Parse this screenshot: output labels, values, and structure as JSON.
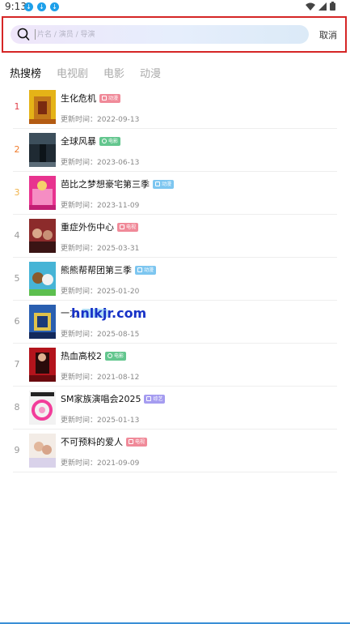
{
  "status_bar": {
    "time": "9:13",
    "download_icons": [
      "download-icon",
      "download-icon",
      "download-icon"
    ]
  },
  "search": {
    "placeholder": "片名 / 演员 / 导演",
    "cancel_label": "取消"
  },
  "tabs": [
    {
      "label": "热搜榜",
      "active": true
    },
    {
      "label": "电视剧",
      "active": false
    },
    {
      "label": "电影",
      "active": false
    },
    {
      "label": "动漫",
      "active": false
    }
  ],
  "update_prefix": "更新时间：",
  "items": [
    {
      "rank": "1",
      "title": "生化危机",
      "badge": "动漫",
      "update": "2022-09-13",
      "rank_color": "#e0404a",
      "badge_color": "#f08a99"
    },
    {
      "rank": "2",
      "title": "全球风暴",
      "badge": "电影",
      "update": "2023-06-13",
      "rank_color": "#f07a2a",
      "badge_color": "#63c68e"
    },
    {
      "rank": "3",
      "title": "芭比之梦想豪宅第三季",
      "badge": "动漫",
      "update": "2023-11-09",
      "rank_color": "#f0b34a",
      "badge_color": "#7dc6f0"
    },
    {
      "rank": "4",
      "title": "重症外伤中心",
      "badge": "电视",
      "update": "2025-03-31",
      "rank_color": "#999999",
      "badge_color": "#f08a99"
    },
    {
      "rank": "5",
      "title": "熊熊帮帮团第三季",
      "badge": "动漫",
      "update": "2025-01-20",
      "rank_color": "#999999",
      "badge_color": "#7dc6f0"
    },
    {
      "rank": "6",
      "title": "一力",
      "badge": "",
      "update": "2025-08-15",
      "rank_color": "#999999",
      "badge_color": "#7dc6f0"
    },
    {
      "rank": "7",
      "title": "热血高校2",
      "badge": "电影",
      "update": "2021-08-12",
      "rank_color": "#999999",
      "badge_color": "#63c68e"
    },
    {
      "rank": "8",
      "title": "SM家族演唱会2025",
      "badge": "综艺",
      "update": "2025-01-13",
      "rank_color": "#999999",
      "badge_color": "#a59cf0"
    },
    {
      "rank": "9",
      "title": "不可预料的爱人",
      "badge": "电视",
      "update": "2021-09-09",
      "rank_color": "#999999",
      "badge_color": "#f08a99"
    }
  ],
  "watermark": "hnlkjr.com",
  "colors": {
    "accent_frame": "#d52626",
    "rank_1": "#e0404a",
    "rank_2": "#f07a2a",
    "rank_3": "#f0b34a"
  }
}
